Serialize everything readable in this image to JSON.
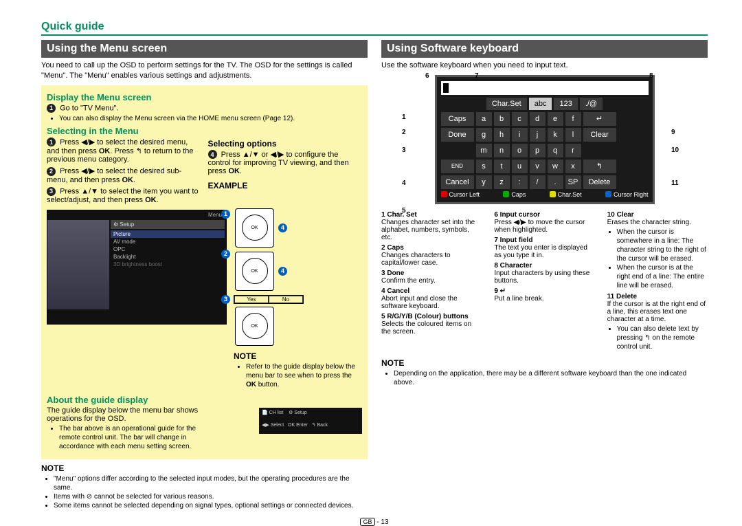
{
  "header": {
    "quick_guide": "Quick guide"
  },
  "left": {
    "title": "Using the Menu screen",
    "intro": "You need to call up the OSD to perform settings for the TV. The OSD for the settings is called \"Menu\". The \"Menu\" enables various settings and adjustments.",
    "display_h": "Display the Menu screen",
    "display_step": "Go to \"TV Menu\".",
    "display_sub": "You can also display the Menu screen via the HOME menu screen (Page 12).",
    "selecting_h": "Selecting in the Menu",
    "sel_step1a": "Press ◀/▶ to select the desired menu, and then press ",
    "sel_step1b": ". Press ↰ to return to the previous menu category.",
    "sel_step2": "Press ◀/▶ to select the desired sub-menu, and then press ",
    "sel_step3": "Press ▲/▼ to select the item you want to select/adjust, and then press ",
    "ok": "OK",
    "sel_opt_h": "Selecting options",
    "sel_opt_text_a": "Press ▲/▼ or ◀/▶ to configure the control for improving TV viewing, and then press ",
    "example_h": "EXAMPLE",
    "about_h": "About the guide display",
    "about_text": "The guide display below the menu bar shows operations for the OSD.",
    "about_sub": "The bar above is an operational guide for the remote control unit. The bar will change in accordance with each menu setting screen.",
    "note_h": "NOTE",
    "note_items": [
      "\"Menu\" options differ according to the selected input modes, but the operating procedures are the same.",
      "Items with ⊘ cannot be selected for various reasons.",
      "Some items cannot be selected depending on signal types, optional settings or connected devices."
    ],
    "menu": {
      "title": "Menu",
      "chlist": "CH list",
      "setup": "Setup",
      "items": [
        "Picture",
        "AV mode",
        "OPC",
        "Backlight",
        "3D brightness boost"
      ],
      "back": "Back",
      "yes": "Yes",
      "no": "No"
    },
    "guidebar": {
      "chlist": "CH list",
      "setup": "Setup",
      "select": "Select",
      "enter": "Enter",
      "back": "Back"
    }
  },
  "right": {
    "title": "Using Software keyboard",
    "intro": "Use the software keyboard when you need to input text.",
    "kb": {
      "tabs": {
        "charset": "Char.Set",
        "abc": "abc",
        "num": "123",
        "sym": "./@"
      },
      "caps": "Caps",
      "done": "Done",
      "end": "END",
      "cancel": "Cancel",
      "clear": "Clear",
      "delete": "Delete",
      "sp": "SP",
      "enter": "↵",
      "back": "↰",
      "rows": [
        [
          "a",
          "b",
          "c",
          "d",
          "e",
          "f"
        ],
        [
          "g",
          "h",
          "i",
          "j",
          "k",
          "l"
        ],
        [
          "m",
          "n",
          "o",
          "p",
          "q",
          "r"
        ],
        [
          "s",
          "t",
          "u",
          "v",
          "w",
          "x"
        ],
        [
          "y",
          "z",
          ":",
          "/",
          ".",
          ""
        ]
      ],
      "colorbar": {
        "r": "Cursor Left",
        "g": "Caps",
        "y": "Char.Set",
        "b": "Cursor Right"
      }
    },
    "callout_nums": {
      "n1": "1",
      "n2": "2",
      "n3": "3",
      "n4": "4",
      "n5": "5",
      "n6": "6",
      "n7": "7",
      "n8": "8",
      "n9": "9",
      "n10": "10",
      "n11": "11"
    },
    "legend": {
      "c1": [
        {
          "n": "1",
          "t": "Char. Set",
          "d": "Changes character set into the alphabet, numbers, symbols, etc."
        },
        {
          "n": "2",
          "t": "Caps",
          "d": "Changes characters to capital/lower case."
        },
        {
          "n": "3",
          "t": "Done",
          "d": "Confirm the entry."
        },
        {
          "n": "4",
          "t": "Cancel",
          "d": "Abort input and close the software keyboard."
        },
        {
          "n": "5",
          "t": "R/G/Y/B (Colour) buttons",
          "d": "Selects the coloured items on the screen."
        }
      ],
      "c2": [
        {
          "n": "6",
          "t": "Input cursor",
          "d": "Press ◀/▶ to move the cursor when highlighted."
        },
        {
          "n": "7",
          "t": "Input field",
          "d": "The text you enter is displayed as you type it in."
        },
        {
          "n": "8",
          "t": "Character",
          "d": "Input characters by using these buttons."
        },
        {
          "n": "9",
          "t": "↵",
          "d": "Put a line break."
        }
      ],
      "c3": [
        {
          "n": "10",
          "t": "Clear",
          "d": "Erases the character string.",
          "sub": [
            "When the cursor is somewhere in a line: The character string to the right of the cursor will be erased.",
            "When the cursor is at the right end of a line: The entire line will be erased."
          ]
        },
        {
          "n": "11",
          "t": "Delete",
          "d": "If the cursor is at the right end of a line, this erases text one character at a time.",
          "sub": [
            "You can also delete text by pressing ↰ on the remote control unit."
          ]
        }
      ]
    },
    "note_h": "NOTE",
    "note_item": "Depending on the application, there may be a different software keyboard than the one indicated above."
  },
  "footer": {
    "gb": "GB",
    "page": "13"
  }
}
